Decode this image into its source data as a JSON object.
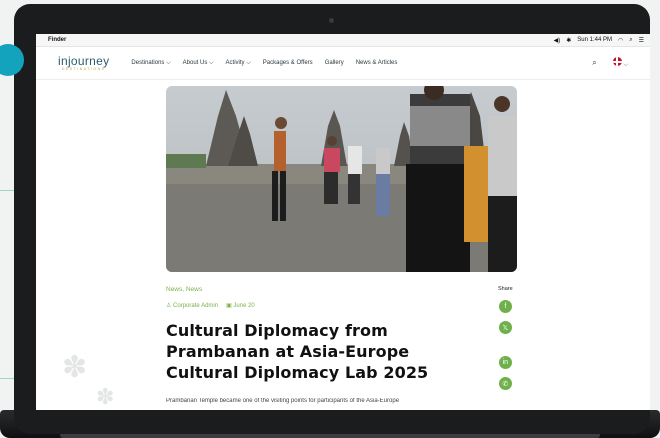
{
  "menubar": {
    "app": "Finder",
    "clock": "Sun 1:44 PM"
  },
  "brand": {
    "name": "injourney",
    "tagline": "DESTINATIONS"
  },
  "nav": {
    "items": [
      {
        "label": "Destinations ⌵"
      },
      {
        "label": "About Us ⌵"
      },
      {
        "label": "Activity ⌵"
      },
      {
        "label": "Packages & Offers"
      },
      {
        "label": "Gallery"
      },
      {
        "label": "News & Articles"
      }
    ]
  },
  "article": {
    "category": "News, News",
    "author": "Corporate Admin",
    "date": "June 20",
    "title": "Cultural Diplomacy from Prambanan at Asia-Europe Cultural Diplomacy Lab 2025",
    "excerpt": "Prambanan Temple became one of the visiting points for participants of the Asia-Europe"
  },
  "share": {
    "label": "Share"
  },
  "colors": {
    "accent": "#7bb24a",
    "brand": "#2c5d6b",
    "teal": "#14a3bd"
  }
}
